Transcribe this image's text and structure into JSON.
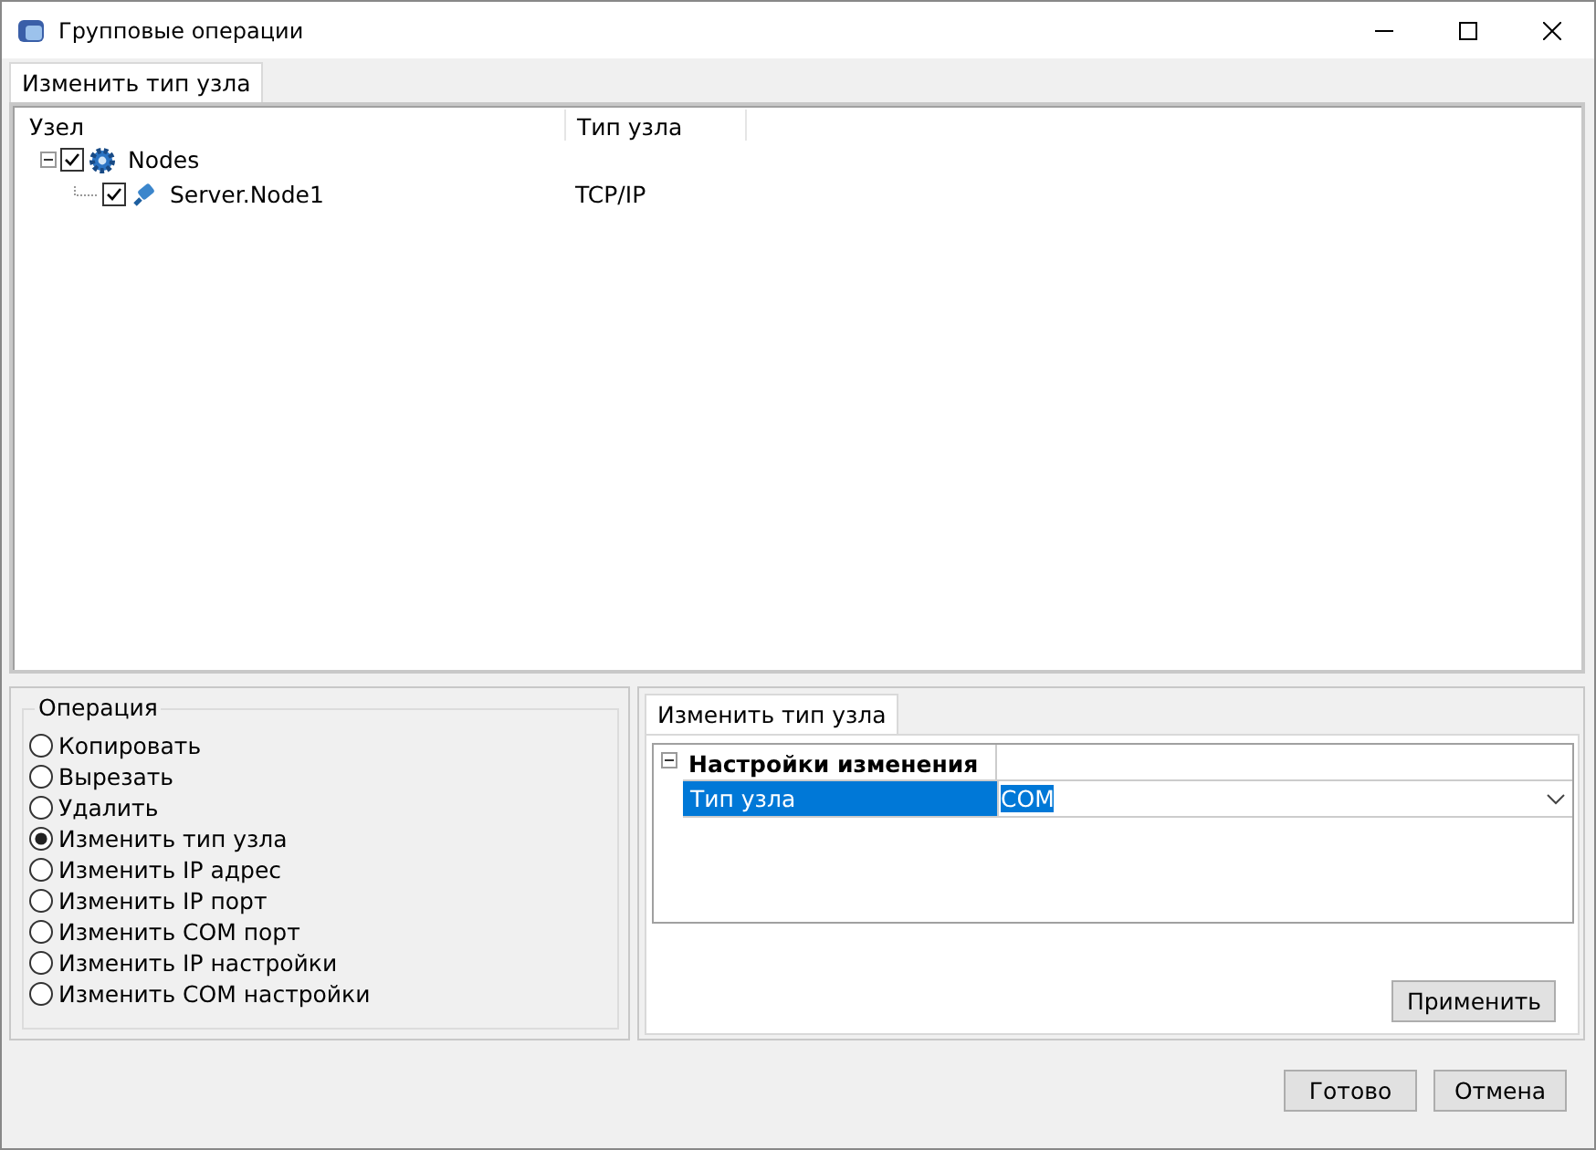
{
  "window": {
    "title": "Групповые операции"
  },
  "top_tabs": [
    {
      "label": "Изменить тип узла",
      "selected": true
    }
  ],
  "tree": {
    "columns": [
      "Узел",
      "Тип узла"
    ],
    "items": [
      {
        "label": "Nodes",
        "checked": true,
        "expanded": true,
        "kind": "group",
        "children": [
          {
            "label": "Server.Node1",
            "checked": true,
            "kind": "node",
            "type": "TCP/IP"
          }
        ]
      }
    ]
  },
  "operation": {
    "title": "Операция",
    "options": [
      {
        "label": "Копировать",
        "selected": false
      },
      {
        "label": "Вырезать",
        "selected": false
      },
      {
        "label": "Удалить",
        "selected": false
      },
      {
        "label": "Изменить тип узла",
        "selected": true
      },
      {
        "label": "Изменить IP адрес",
        "selected": false
      },
      {
        "label": "Изменить IP порт",
        "selected": false
      },
      {
        "label": "Изменить COM порт",
        "selected": false
      },
      {
        "label": "Изменить IP настройки",
        "selected": false
      },
      {
        "label": "Изменить COM настройки",
        "selected": false
      }
    ]
  },
  "settings_tabs": [
    {
      "label": "Изменить тип узла",
      "selected": true
    }
  ],
  "properties": {
    "category": "Настройки изменения",
    "expanded": true,
    "rows": [
      {
        "name": "Тип узла",
        "value": "COM",
        "selected": true
      }
    ]
  },
  "apply_button": "Применить",
  "buttons": [
    "Готово",
    "Отмена"
  ]
}
